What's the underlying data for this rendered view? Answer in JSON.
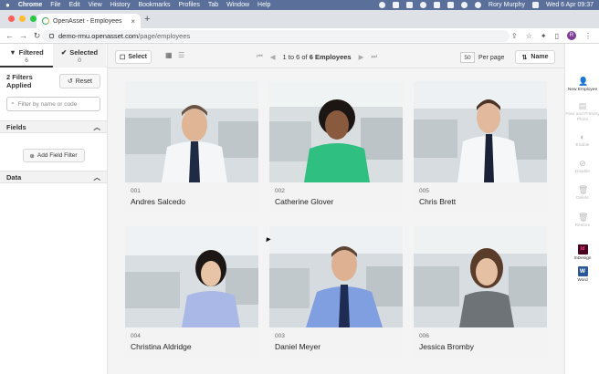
{
  "menubar": {
    "app": "Chrome",
    "items": [
      "File",
      "Edit",
      "View",
      "History",
      "Bookmarks",
      "Profiles",
      "Tab",
      "Window",
      "Help"
    ],
    "user": "Rory Murphy",
    "datetime": "Wed 6 Apr  09:37"
  },
  "browser": {
    "tab_title": "OpenAsset - Employees",
    "url_host": "demo-rmu.openasset.com",
    "url_path": "/page/employees",
    "profile_initial": "R"
  },
  "sidebar": {
    "tab_filtered": "Filtered",
    "tab_filtered_count": "6",
    "tab_selected": "Selected",
    "tab_selected_count": "0",
    "filters_applied": "2 Filters Applied",
    "reset_label": "Reset",
    "search_placeholder": "Filter by name or code",
    "fields_label": "Fields",
    "add_field_filter": "Add Field Filter",
    "data_label": "Data"
  },
  "toolbar": {
    "select_label": "Select",
    "pager_text": "1 to 6 of",
    "pager_bold": "6 Employees",
    "per_page_value": "50",
    "per_page_label": "Per page",
    "sort_label": "Name"
  },
  "employees": [
    {
      "code": "001",
      "name": "Andres Salcedo"
    },
    {
      "code": "002",
      "name": "Catherine Glover"
    },
    {
      "code": "005",
      "name": "Chris Brett"
    },
    {
      "code": "004",
      "name": "Christina Aldridge"
    },
    {
      "code": "003",
      "name": "Daniel Meyer"
    },
    {
      "code": "006",
      "name": "Jessica Bromby"
    }
  ],
  "right_actions": {
    "new_employee": "New Employee",
    "files_primary": "Files and Primary Photo",
    "enable": "Enable",
    "disable": "Disable",
    "delete": "Delete",
    "restore": "Restore",
    "indesign": "InDesign",
    "word": "Word"
  },
  "colors": {
    "menubar": "#5a6f9a",
    "toolbar_bg": "#f4f4f4",
    "indesign": "#49021f",
    "word": "#2b579a"
  }
}
